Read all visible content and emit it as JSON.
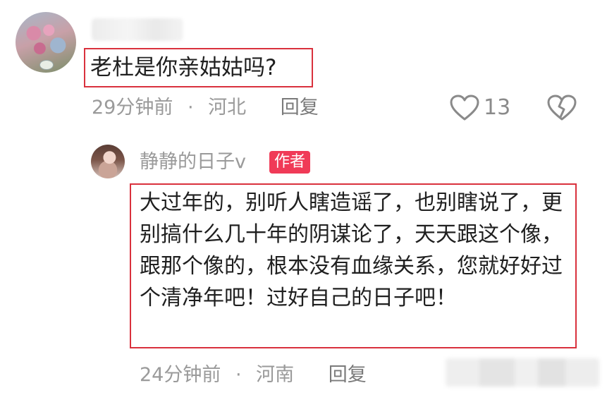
{
  "comment": {
    "question": "老杜是你亲姑姑吗?",
    "time": "29分钟前",
    "separator": "·",
    "location": "河北",
    "reply_label": "回复",
    "like_count": "13"
  },
  "reply": {
    "author": "静静的日子v",
    "author_badge": "作者",
    "text": "大过年的，别听人瞎造谣了，也别瞎说了，更别搞什么几十年的阴谋论了，天天跟这个像，跟那个像的，根本没有血缘关系，您就好好过个清净年吧！过好自己的日子吧！",
    "time": "24分钟前",
    "separator": "·",
    "location": "河南",
    "reply_label": "回复"
  },
  "colors": {
    "highlight_border": "#d9313d",
    "author_badge_bg": "#f03a57",
    "meta_text": "#9a9a9a"
  },
  "icons": {
    "like": "heart-outline-icon",
    "dislike": "broken-heart-icon"
  }
}
